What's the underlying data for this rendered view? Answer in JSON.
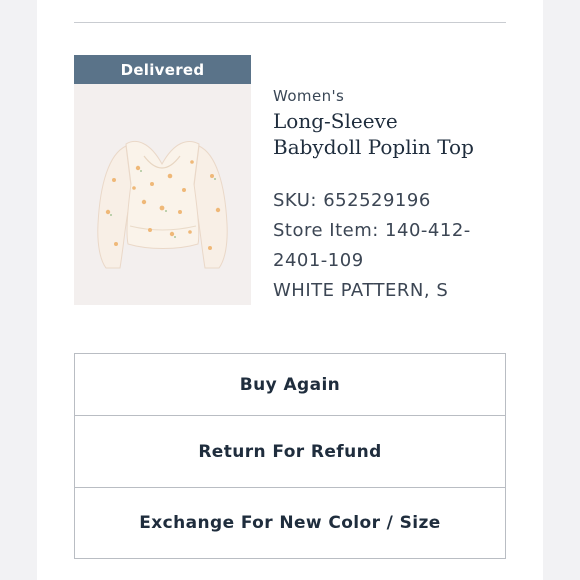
{
  "order_item": {
    "status_badge": "Delivered",
    "gender": "Women's",
    "product_name": "Long-Sleeve Babydoll Poplin Top",
    "sku": "SKU: 652529196",
    "store_item": "Store Item: 140-412-2401-109",
    "variant": "WHITE PATTERN, S",
    "image_icon": "floral-blouse-image"
  },
  "actions": {
    "buy_again": "Buy Again",
    "return_refund": "Return For Refund",
    "exchange": "Exchange For New Color / Size"
  },
  "colors": {
    "badge_bg": "#5a7389",
    "text_primary": "#1f2d3d",
    "border": "#b9bdc3",
    "page_bg": "#f2f2f4"
  }
}
